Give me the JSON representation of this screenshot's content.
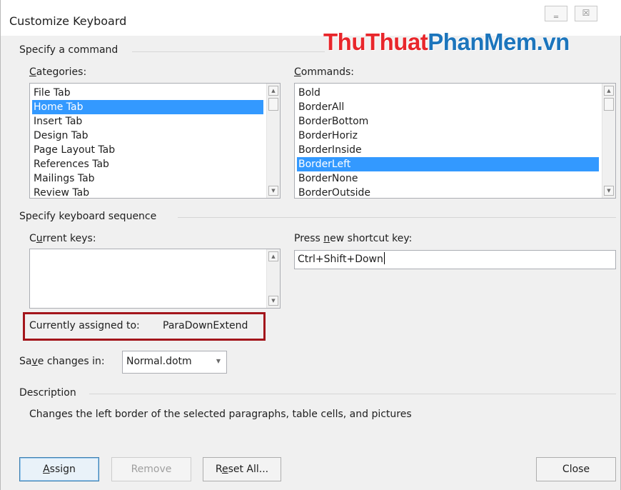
{
  "window": {
    "title": "Customize Keyboard",
    "minimize_glyph": "‗",
    "close_glyph": "☒"
  },
  "watermark": {
    "part1": "ThuThuat",
    "part2": "PhanMem.vn",
    "color1": "#e8262b",
    "color2": "#1c75bc"
  },
  "specify_command": {
    "group_label": "Specify a command",
    "categories": {
      "label_prefix": "",
      "label_mnemonic": "C",
      "label_suffix": "ategories:",
      "items": [
        "File Tab",
        "Home Tab",
        "Insert Tab",
        "Design Tab",
        "Page Layout Tab",
        "References Tab",
        "Mailings Tab",
        "Review Tab"
      ],
      "selected": "Home Tab"
    },
    "commands": {
      "label_prefix": "",
      "label_mnemonic": "C",
      "label_suffix": "ommands:",
      "items": [
        "Bold",
        "BorderAll",
        "BorderBottom",
        "BorderHoriz",
        "BorderInside",
        "BorderLeft",
        "BorderNone",
        "BorderOutside"
      ],
      "selected": "BorderLeft"
    }
  },
  "keyboard_sequence": {
    "group_label": "Specify keyboard sequence",
    "current_keys": {
      "label_prefix": "C",
      "label_mnemonic": "u",
      "label_suffix": "rrent keys:",
      "items": []
    },
    "new_shortcut": {
      "label_prefix": "Press ",
      "label_mnemonic": "n",
      "label_suffix": "ew shortcut key:",
      "value": "Ctrl+Shift+Down"
    },
    "currently_assigned": {
      "label": "Currently assigned to:",
      "value": "ParaDownExtend",
      "highlight_color": "#a3151b"
    }
  },
  "save_changes": {
    "label_prefix": "Sa",
    "label_mnemonic": "v",
    "label_suffix": "e changes in:",
    "selected": "Normal.dotm"
  },
  "description": {
    "group_label": "Description",
    "text": "Changes the left border of the selected paragraphs, table cells, and pictures"
  },
  "buttons": {
    "assign": {
      "prefix": "",
      "mnemonic": "A",
      "suffix": "ssign"
    },
    "remove": {
      "label": "Remove"
    },
    "reset_all": {
      "prefix": "R",
      "mnemonic": "e",
      "suffix": "set All..."
    },
    "close": {
      "label": "Close"
    }
  },
  "colors": {
    "selection": "#3399ff",
    "dialog_bg": "#f0f0f0"
  },
  "icons": {
    "scroll_up": "scroll-up-arrow-icon",
    "scroll_down": "scroll-down-arrow-icon",
    "combo_arrow": "chevron-down-icon"
  }
}
